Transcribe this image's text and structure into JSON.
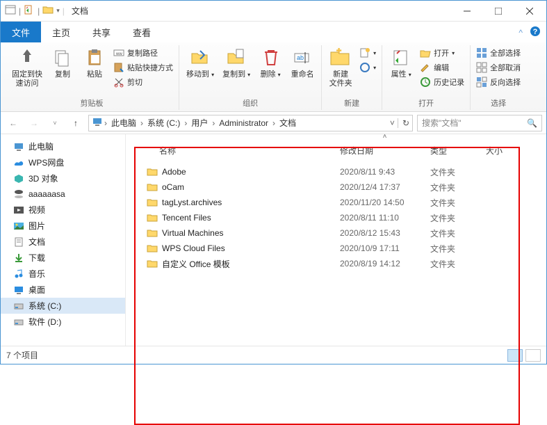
{
  "window": {
    "title": "文档"
  },
  "tabs": {
    "file": "文件",
    "home": "主页",
    "share": "共享",
    "view": "查看"
  },
  "ribbon": {
    "pin": "固定到快\n速访问",
    "copy": "复制",
    "paste": "粘贴",
    "copypath": "复制路径",
    "pasteshortcut": "粘贴快捷方式",
    "cut": "剪切",
    "grp_clipboard": "剪贴板",
    "moveto": "移动到",
    "copyto": "复制到",
    "delete": "删除",
    "rename": "重命名",
    "grp_organize": "组织",
    "newfolder": "新建\n文件夹",
    "grp_new": "新建",
    "properties": "属性",
    "open": "打开",
    "edit": "编辑",
    "history": "历史记录",
    "grp_open": "打开",
    "selectall": "全部选择",
    "selectnone": "全部取消",
    "invertsel": "反向选择",
    "grp_select": "选择"
  },
  "breadcrumbs": {
    "b0": "此电脑",
    "b1": "系统 (C:)",
    "b2": "用户",
    "b3": "Administrator",
    "b4": "文档"
  },
  "search": {
    "placeholder": "搜索\"文档\""
  },
  "nav": {
    "thispc": "此电脑",
    "wps": "WPS网盘",
    "obj3d": "3D 对象",
    "aaa": "aaaaaasa",
    "videos": "视频",
    "pictures": "图片",
    "documents": "文档",
    "downloads": "下载",
    "music": "音乐",
    "desktop": "桌面",
    "drivec": "系统 (C:)",
    "drived": "软件 (D:)"
  },
  "columns": {
    "name": "名称",
    "date": "修改日期",
    "type": "类型",
    "size": "大小"
  },
  "files": [
    {
      "name": "Adobe",
      "date": "2020/8/11 9:43",
      "type": "文件夹"
    },
    {
      "name": "oCam",
      "date": "2020/12/4 17:37",
      "type": "文件夹"
    },
    {
      "name": "tagLyst.archives",
      "date": "2020/11/20 14:50",
      "type": "文件夹"
    },
    {
      "name": "Tencent Files",
      "date": "2020/8/11 11:10",
      "type": "文件夹"
    },
    {
      "name": "Virtual Machines",
      "date": "2020/8/12 15:43",
      "type": "文件夹"
    },
    {
      "name": "WPS Cloud Files",
      "date": "2020/10/9 17:11",
      "type": "文件夹"
    },
    {
      "name": "自定义 Office 模板",
      "date": "2020/8/19 14:12",
      "type": "文件夹"
    }
  ],
  "status": {
    "count": "7 个项目"
  }
}
